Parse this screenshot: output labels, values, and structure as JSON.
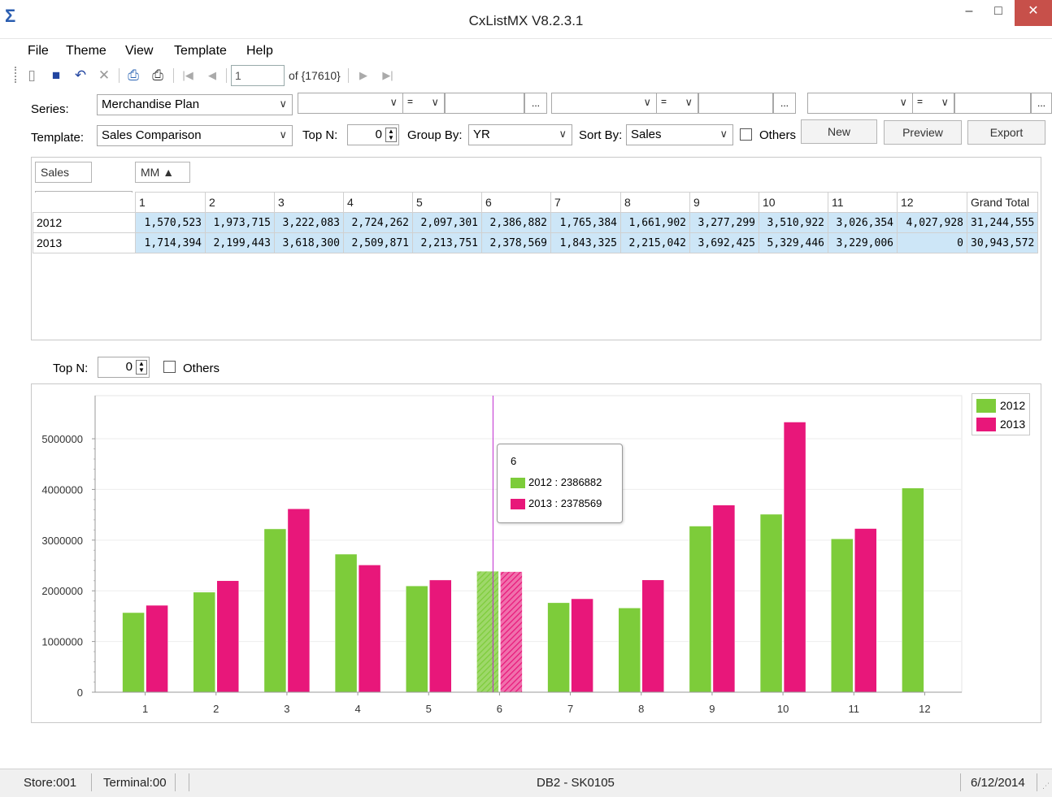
{
  "window": {
    "title": "CxListMX  V8.2.3.1",
    "minimize": "–",
    "maximize": "□",
    "close": "✕"
  },
  "menu": [
    "File",
    "Theme",
    "View",
    "Template",
    "Help"
  ],
  "toolbar": {
    "record_value": "1",
    "record_of": "of {17610}"
  },
  "filters": {
    "series_label": "Series:",
    "series_value": "Merchandise Plan",
    "template_label": "Template:",
    "template_value": "Sales Comparison",
    "topn_label": "Top N:",
    "topn_value": "0",
    "groupby_label": "Group By:",
    "groupby_value": "YR",
    "sortby_label": "Sort By:",
    "sortby_value": "Sales",
    "others_label": "Others",
    "eq": "=",
    "ellipsis": "...",
    "new_label": "New",
    "preview_label": "Preview",
    "export_label": "Export"
  },
  "pivot": {
    "data_field": "Sales",
    "col_field": "MM ▲",
    "row_field": "YR",
    "columns": [
      "1",
      "2",
      "3",
      "4",
      "5",
      "6",
      "7",
      "8",
      "9",
      "10",
      "11",
      "12",
      "Grand Total"
    ],
    "rows": [
      {
        "label": "2012",
        "cells": [
          "1,570,523",
          "1,973,715",
          "3,222,083",
          "2,724,262",
          "2,097,301",
          "2,386,882",
          "1,765,384",
          "1,661,902",
          "3,277,299",
          "3,510,922",
          "3,026,354",
          "4,027,928",
          "31,244,555"
        ]
      },
      {
        "label": "2013",
        "cells": [
          "1,714,394",
          "2,199,443",
          "3,618,300",
          "2,509,871",
          "2,213,751",
          "2,378,569",
          "1,843,325",
          "2,215,042",
          "3,692,425",
          "5,329,446",
          "3,229,006",
          "0",
          "30,943,572"
        ]
      }
    ]
  },
  "chart_controls": {
    "topn_label": "Top N:",
    "topn_value": "0",
    "others_label": "Others"
  },
  "chart_data": {
    "type": "bar",
    "categories": [
      "1",
      "2",
      "3",
      "4",
      "5",
      "6",
      "7",
      "8",
      "9",
      "10",
      "11",
      "12"
    ],
    "series": [
      {
        "name": "2012",
        "color": "#7dcc3a",
        "values": [
          1570523,
          1973715,
          3222083,
          2724262,
          2097301,
          2386882,
          1765384,
          1661902,
          3277299,
          3510922,
          3026354,
          4027928
        ]
      },
      {
        "name": "2013",
        "color": "#e8177a",
        "values": [
          1714394,
          2199443,
          3618300,
          2509871,
          2213751,
          2378569,
          1843325,
          2215042,
          3692425,
          5329446,
          3229006,
          0
        ]
      }
    ],
    "yticks": [
      "0",
      "1000000",
      "2000000",
      "3000000",
      "4000000",
      "5000000"
    ],
    "ylim": [
      0,
      5850000
    ],
    "legend": "top-right",
    "highlight_category": "6",
    "tooltip": {
      "title": "6",
      "lines": [
        "2012 : 2386882",
        "2013 : 2378569"
      ]
    }
  },
  "status": {
    "store": "Store:001",
    "terminal": "Terminal:00",
    "db": "DB2 - SK0105",
    "date": "6/12/2014"
  }
}
